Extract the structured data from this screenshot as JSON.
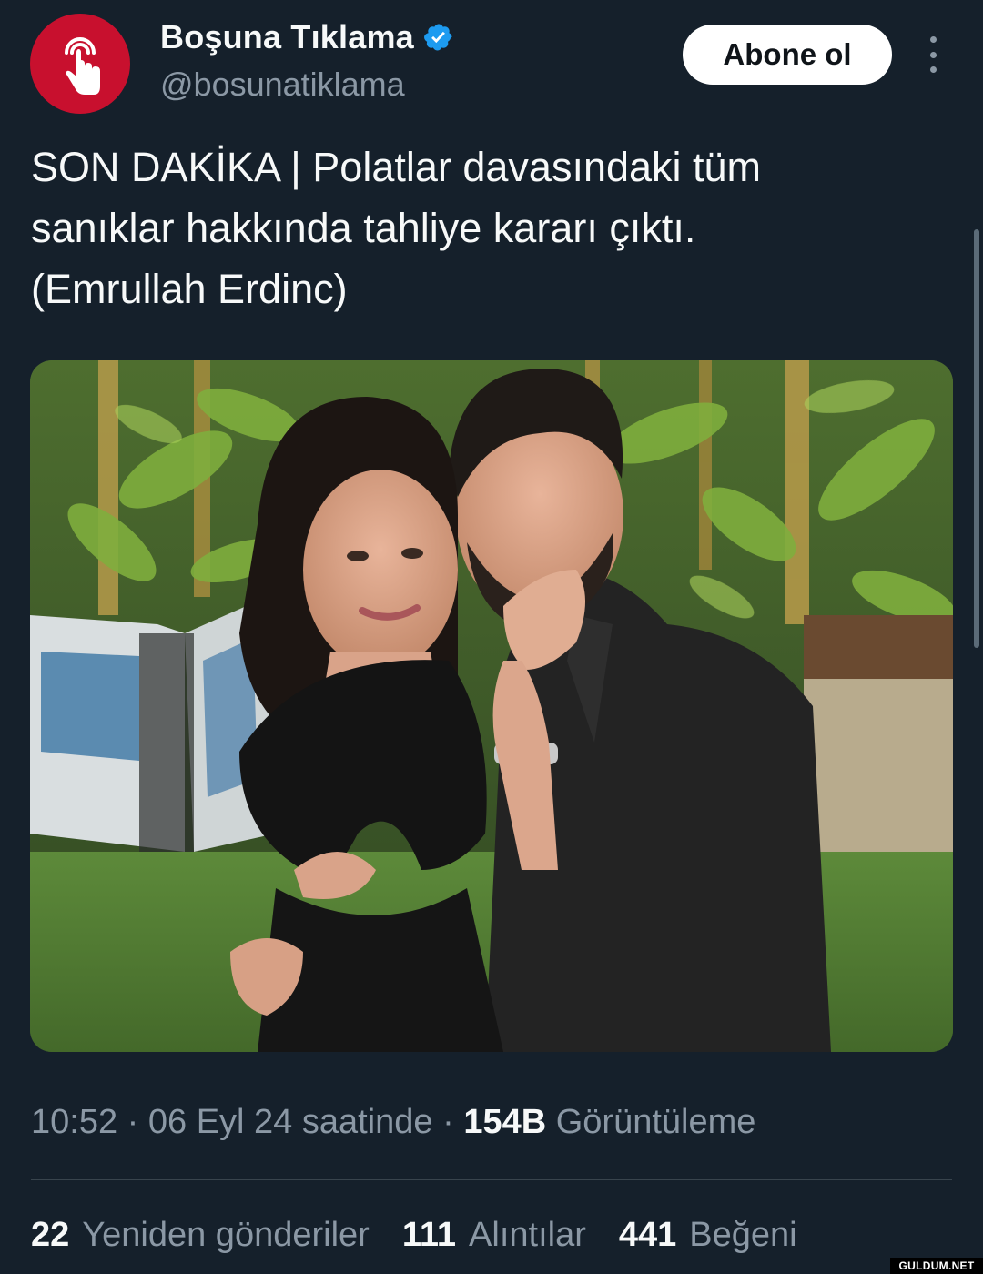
{
  "author": {
    "display_name": "Boşuna Tıklama",
    "handle": "@bosunatiklama",
    "verified_icon": "verified-badge-icon",
    "avatar_icon": "tap-finger-icon",
    "avatar_color": "#c8102e"
  },
  "header": {
    "subscribe_label": "Abone ol",
    "more_icon": "more-vertical-icon"
  },
  "tweet": {
    "text_lines": [
      "SON DAKİKA | Polatlar davasındaki tüm",
      "sanıklar hakkında tahliye kararı çıktı.",
      "(Emrullah Erdinc)"
    ]
  },
  "meta": {
    "time": "10:52",
    "sep1": " · ",
    "date": "06 Eyl 24 saatinde",
    "sep2": " · ",
    "views_count": "154B",
    "views_label": "Görüntüleme"
  },
  "stats": {
    "retweets_count": "22",
    "retweets_label": "Yeniden gönderiler",
    "quotes_count": "111",
    "quotes_label": "Alıntılar",
    "likes_count": "441",
    "likes_label": "Beğeni"
  },
  "watermark": "GULDUM.NET",
  "colors": {
    "background": "#15202b",
    "text": "#f7f9f9",
    "muted": "#8b98a5",
    "verified": "#1d9bf0",
    "divider": "#38444d"
  }
}
